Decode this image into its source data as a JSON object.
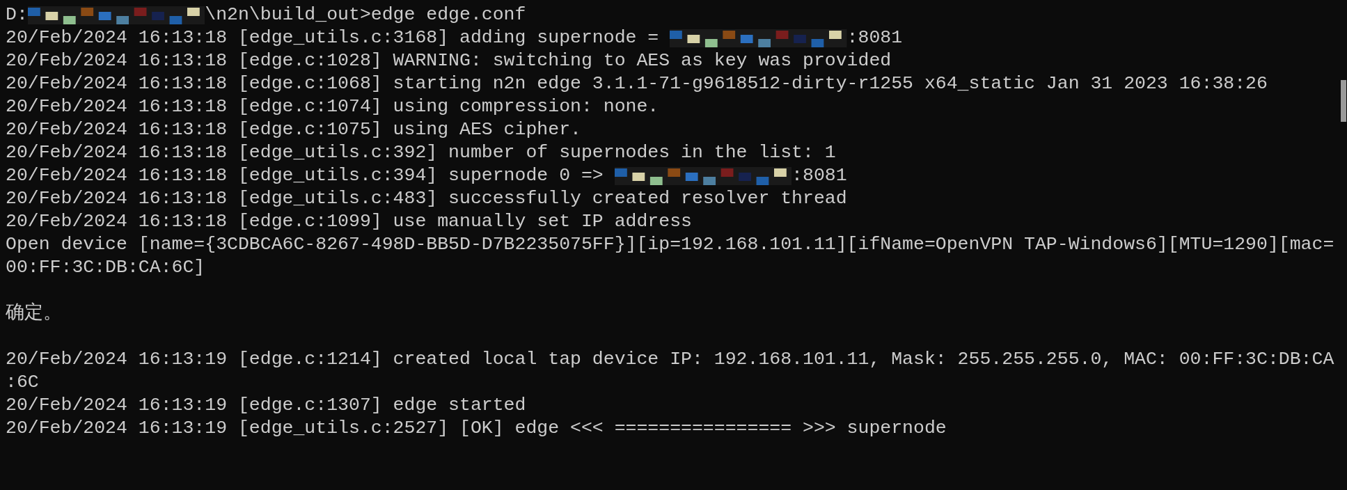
{
  "terminal": {
    "lines": [
      {
        "kind": "line",
        "parts": [
          {
            "kind": "text",
            "text": "D:"
          },
          {
            "kind": "redacted"
          },
          {
            "kind": "text",
            "text": "\\n2n\\build_out>edge edge.conf"
          }
        ]
      },
      {
        "kind": "line",
        "parts": [
          {
            "kind": "text",
            "text": "20/Feb/2024 16:13:18 [edge_utils.c:3168] adding supernode = "
          },
          {
            "kind": "redacted"
          },
          {
            "kind": "text",
            "text": ":8081"
          }
        ]
      },
      {
        "kind": "line",
        "parts": [
          {
            "kind": "text",
            "text": "20/Feb/2024 16:13:18 [edge.c:1028] WARNING: switching to AES as key was provided"
          }
        ]
      },
      {
        "kind": "line",
        "parts": [
          {
            "kind": "text",
            "text": "20/Feb/2024 16:13:18 [edge.c:1068] starting n2n edge 3.1.1-71-g9618512-dirty-r1255 x64_static Jan 31 2023 16:38:26"
          }
        ]
      },
      {
        "kind": "line",
        "parts": [
          {
            "kind": "text",
            "text": "20/Feb/2024 16:13:18 [edge.c:1074] using compression: none."
          }
        ]
      },
      {
        "kind": "line",
        "parts": [
          {
            "kind": "text",
            "text": "20/Feb/2024 16:13:18 [edge.c:1075] using AES cipher."
          }
        ]
      },
      {
        "kind": "line",
        "parts": [
          {
            "kind": "text",
            "text": "20/Feb/2024 16:13:18 [edge_utils.c:392] number of supernodes in the list: 1"
          }
        ]
      },
      {
        "kind": "line",
        "parts": [
          {
            "kind": "text",
            "text": "20/Feb/2024 16:13:18 [edge_utils.c:394] supernode 0 => "
          },
          {
            "kind": "redacted"
          },
          {
            "kind": "text",
            "text": ":8081"
          }
        ]
      },
      {
        "kind": "line",
        "parts": [
          {
            "kind": "text",
            "text": "20/Feb/2024 16:13:18 [edge_utils.c:483] successfully created resolver thread"
          }
        ]
      },
      {
        "kind": "line",
        "parts": [
          {
            "kind": "text",
            "text": "20/Feb/2024 16:13:18 [edge.c:1099] use manually set IP address"
          }
        ]
      },
      {
        "kind": "line",
        "parts": [
          {
            "kind": "text",
            "text": "Open device [name={3CDBCA6C-8267-498D-BB5D-D7B2235075FF}][ip=192.168.101.11][ifName=OpenVPN TAP-Windows6][MTU=1290][mac="
          }
        ]
      },
      {
        "kind": "line",
        "parts": [
          {
            "kind": "text",
            "text": "00:FF:3C:DB:CA:6C]"
          }
        ]
      },
      {
        "kind": "blank"
      },
      {
        "kind": "line",
        "parts": [
          {
            "kind": "text",
            "text": "确定。"
          }
        ]
      },
      {
        "kind": "blank"
      },
      {
        "kind": "line",
        "parts": [
          {
            "kind": "text",
            "text": "20/Feb/2024 16:13:19 [edge.c:1214] created local tap device IP: 192.168.101.11, Mask: 255.255.255.0, MAC: 00:FF:3C:DB:CA"
          }
        ]
      },
      {
        "kind": "line",
        "parts": [
          {
            "kind": "text",
            "text": ":6C"
          }
        ]
      },
      {
        "kind": "line",
        "parts": [
          {
            "kind": "text",
            "text": "20/Feb/2024 16:13:19 [edge.c:1307] edge started"
          }
        ]
      },
      {
        "kind": "line",
        "parts": [
          {
            "kind": "text",
            "text": "20/Feb/2024 16:13:19 [edge_utils.c:2527] [OK] edge <<< ================ >>> supernode"
          }
        ]
      }
    ]
  }
}
